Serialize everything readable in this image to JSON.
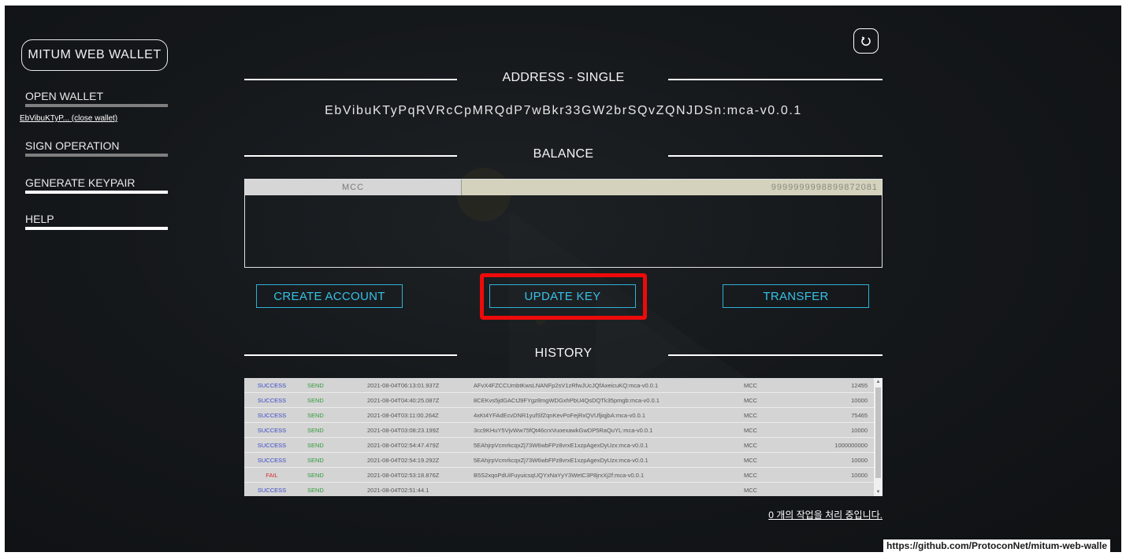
{
  "sidebar": {
    "brand": "MITUM WEB WALLET",
    "open_wallet": "OPEN WALLET",
    "wallet_link": "EbVibuKTyP... (close wallet)",
    "sign_operation": "SIGN OPERATION",
    "generate_keypair": "GENERATE KEYPAIR",
    "help": "HELP"
  },
  "address_section": {
    "title": "ADDRESS - SINGLE",
    "address": "EbVibuKTyPqRVRcCpMRQdP7wBkr33GW2brSQvZQNJDSn:mca-v0.0.1"
  },
  "balance_section": {
    "title": "BALANCE",
    "rows": [
      {
        "currency": "MCC",
        "amount": "9999999998899872081"
      }
    ]
  },
  "actions": {
    "create_account": "CREATE ACCOUNT",
    "update_key": "UPDATE KEY",
    "transfer": "TRANSFER"
  },
  "history_section": {
    "title": "HISTORY",
    "rows": [
      {
        "status": "SUCCESS",
        "type": "SEND",
        "time": "2021-08-04T06:13:01.937Z",
        "address": "AFvX4FZCCUmbtKwsLNANFp2sV1zRfwJUcJQfAxeicuKQ:mca-v0.0.1",
        "currency": "MCC",
        "amount": "12455"
      },
      {
        "status": "SUCCESS",
        "type": "SEND",
        "time": "2021-08-04T04:40:25.087Z",
        "address": "8CEKvs5jdGACtJ9FYgz8mgWDGxhPbU4QsDQTk35pmgb:mca-v0.0.1",
        "currency": "MCC",
        "amount": "10000"
      },
      {
        "status": "SUCCESS",
        "type": "SEND",
        "time": "2021-08-04T03:11:00.264Z",
        "address": "4xKt4YFAdEcvDNR1yufSfZqnKevPoFejRxQVUfjiqjbA:mca-v0.0.1",
        "currency": "MCC",
        "amount": "75465"
      },
      {
        "status": "SUCCESS",
        "type": "SEND",
        "time": "2021-08-04T03:08:23.199Z",
        "address": "3cc9KHuY5VjvWw75fQt46crxVuoexawkGwDP5RaQuYL:mca-v0.0.1",
        "currency": "MCC",
        "amount": "10000"
      },
      {
        "status": "SUCCESS",
        "type": "SEND",
        "time": "2021-08-04T02:54:47.479Z",
        "address": "5EAhjrpVcmrkcqxZj73W6wbFPz8vrxE1xzpAgexDyUzx:mca-v0.0.1",
        "currency": "MCC",
        "amount": "1000000000"
      },
      {
        "status": "SUCCESS",
        "type": "SEND",
        "time": "2021-08-04T02:54:19.292Z",
        "address": "5EAhjrpVcmrkcqxZj73W6wbFPz8vrxE1xzpAgexDyUzx:mca-v0.0.1",
        "currency": "MCC",
        "amount": "10000"
      },
      {
        "status": "FAIL",
        "type": "SEND",
        "time": "2021-08-04T02:53:18.876Z",
        "address": "B5S2xqoPdUiFuyuicsqUQYxNaYyY3WetC3P8jrxXj2f:mca-v0.0.1",
        "currency": "MCC",
        "amount": "10000"
      },
      {
        "status": "SUCCESS",
        "type": "SEND",
        "time": "2021-08-04T02:51:44.1",
        "address": "",
        "currency": "MCC",
        "amount": ""
      }
    ]
  },
  "status_message": "0 개의 작업을 처리 중입니다.",
  "url_hint": "https://github.com/ProtoconNet/mitum-web-walle",
  "colors": {
    "accent": "#37c0e6",
    "highlight": "#ee0a0a",
    "success": "#3b4bc8",
    "fail": "#d43030",
    "send": "#2f9b3a"
  }
}
